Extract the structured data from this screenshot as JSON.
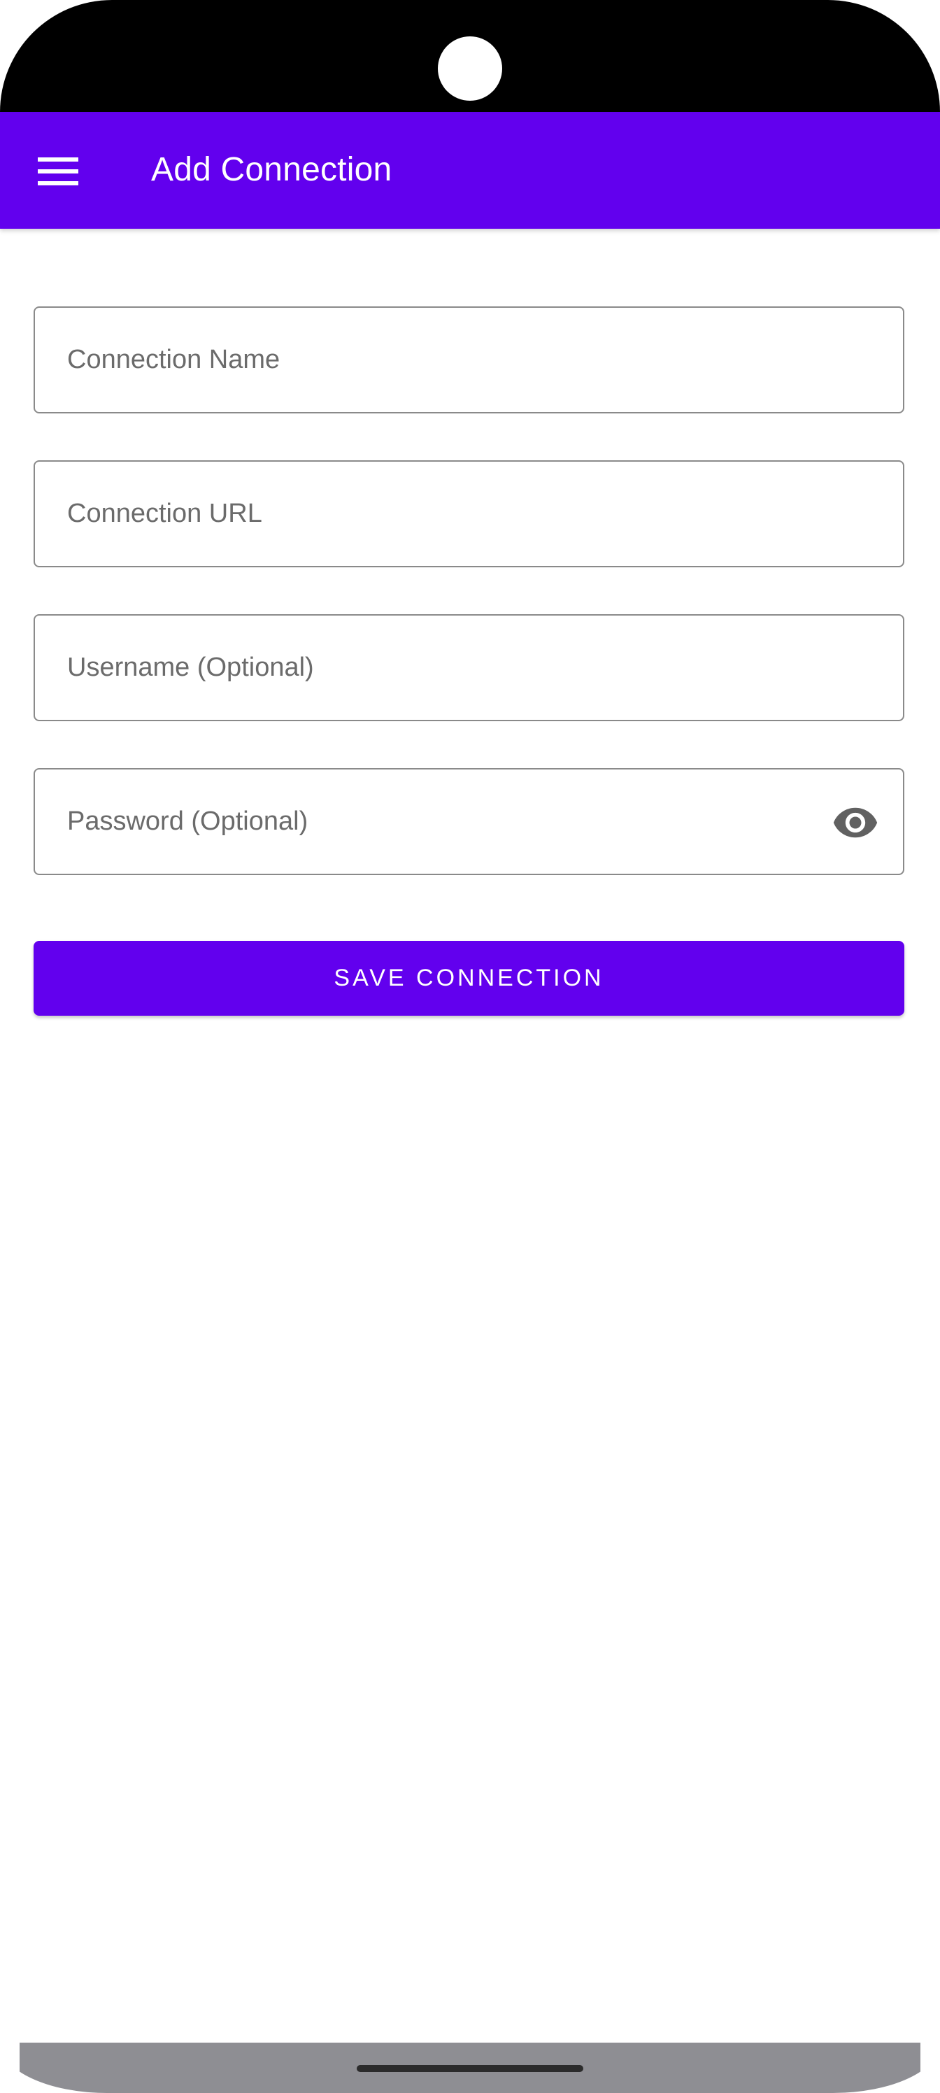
{
  "app_bar": {
    "title": "Add Connection",
    "menu_icon": "hamburger-menu-icon",
    "color": "#6200ee"
  },
  "form": {
    "connection_name": {
      "placeholder": "Connection Name",
      "value": ""
    },
    "connection_url": {
      "placeholder": "Connection URL",
      "value": ""
    },
    "username": {
      "placeholder": "Username (Optional)",
      "value": ""
    },
    "password": {
      "placeholder": "Password (Optional)",
      "value": "",
      "toggle_icon": "eye-icon"
    },
    "save_label": "SAVE CONNECTION"
  },
  "colors": {
    "accent": "#6200ee",
    "status_bar": "#000000",
    "field_border": "#8a8a8a",
    "placeholder_text": "#6b6b6b",
    "nav_bar": "#8e8e93"
  }
}
